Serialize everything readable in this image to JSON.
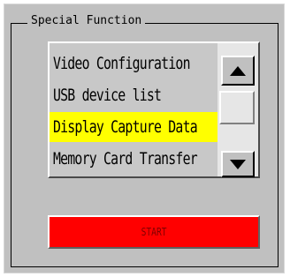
{
  "group": {
    "title": "Special Function"
  },
  "list": {
    "items": [
      {
        "label": "Video Configuration",
        "selected": false
      },
      {
        "label": "USB device list",
        "selected": false
      },
      {
        "label": "Display Capture Data",
        "selected": true
      },
      {
        "label": "Memory Card Transfer",
        "selected": false
      }
    ],
    "selected_color": "#ffff00"
  },
  "scrollbar": {
    "up_icon": "triangle-up-icon",
    "down_icon": "triangle-down-icon"
  },
  "start_button": {
    "label": "START",
    "color": "#ff0000"
  }
}
